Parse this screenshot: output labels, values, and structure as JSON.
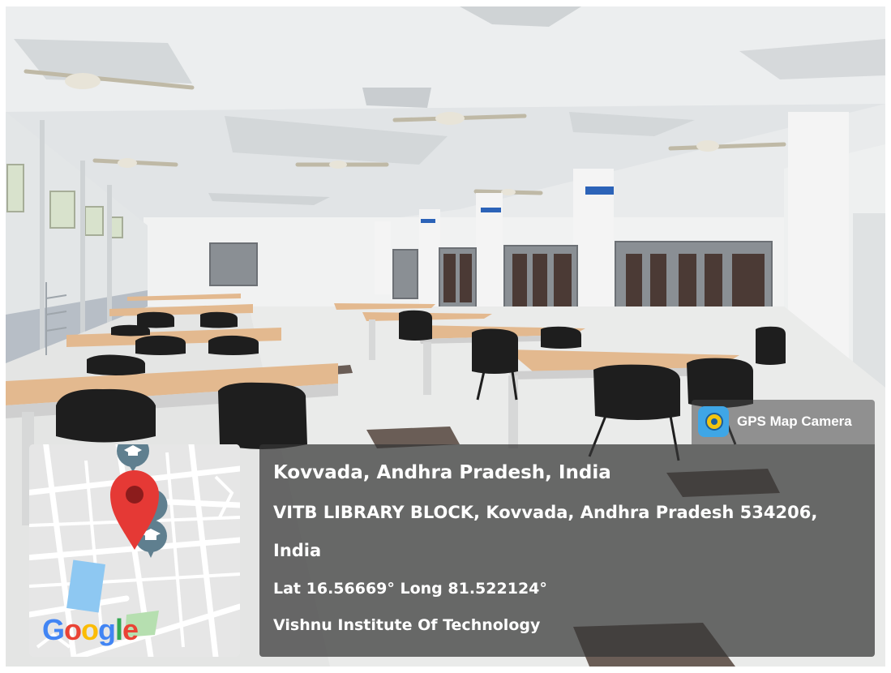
{
  "overlay": {
    "app_name": "GPS Map Camera",
    "app_icon": "gps-camera-icon",
    "location_title": "Kovvada, Andhra Pradesh, India",
    "address_line_1": "VITB LIBRARY BLOCK, Kovvada, Andhra Pradesh 534206,",
    "address_line_2": "India",
    "coordinates": "Lat 16.56669° Long 81.522124°",
    "place_name": "Vishnu Institute Of Technology"
  },
  "map": {
    "brand": "Google",
    "marker_icon": "map-pin-icon",
    "poi_icon": "graduation-cap-icon",
    "pin_color": "#e53935",
    "poi_color": "#5f7f8f"
  },
  "colors": {
    "panel": "#343434",
    "panel_text": "#ffffff",
    "desk_top": "#e3b98f",
    "chair": "#1e1e1e"
  }
}
